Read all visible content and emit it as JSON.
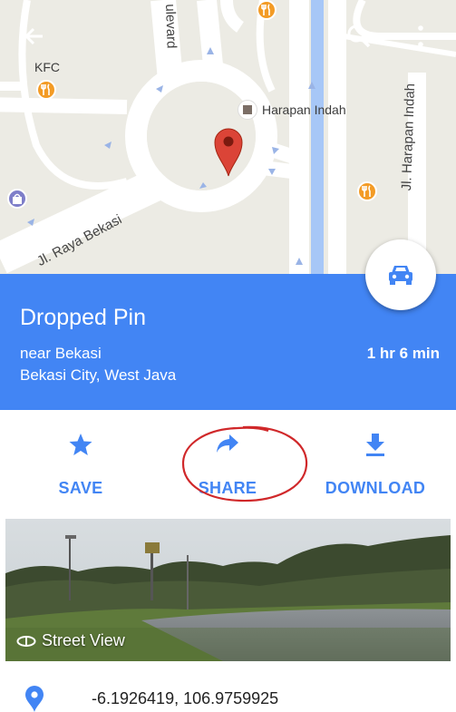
{
  "map": {
    "poi_kfc": "KFC",
    "poi_harapan_indah": "Harapan Indah",
    "street_boulevard": "ulevard",
    "street_raya_bekasi": "Jl. Raya Bekasi",
    "street_harapan_indah": "Jl. Harapan Indah",
    "pin_color": "#db4437",
    "restaurant_color": "#f39b25"
  },
  "place": {
    "title": "Dropped Pin",
    "near": "near Bekasi",
    "city": "Bekasi City, West Java",
    "eta": "1 hr 6 min",
    "card_color": "#4285f4"
  },
  "actions": {
    "save": "SAVE",
    "share": "SHARE",
    "download": "DOWNLOAD"
  },
  "street_view": {
    "label": "Street View"
  },
  "coordinates": {
    "text": "-6.1926419, 106.9759925"
  },
  "icons": {
    "back": "arrow-back-icon",
    "search": "search-icon",
    "more": "more-vert-icon",
    "car": "car-icon",
    "star": "star-icon",
    "share": "share-arrow-icon",
    "download": "download-icon",
    "street_view": "street-view-icon",
    "location": "location-pin-icon"
  }
}
